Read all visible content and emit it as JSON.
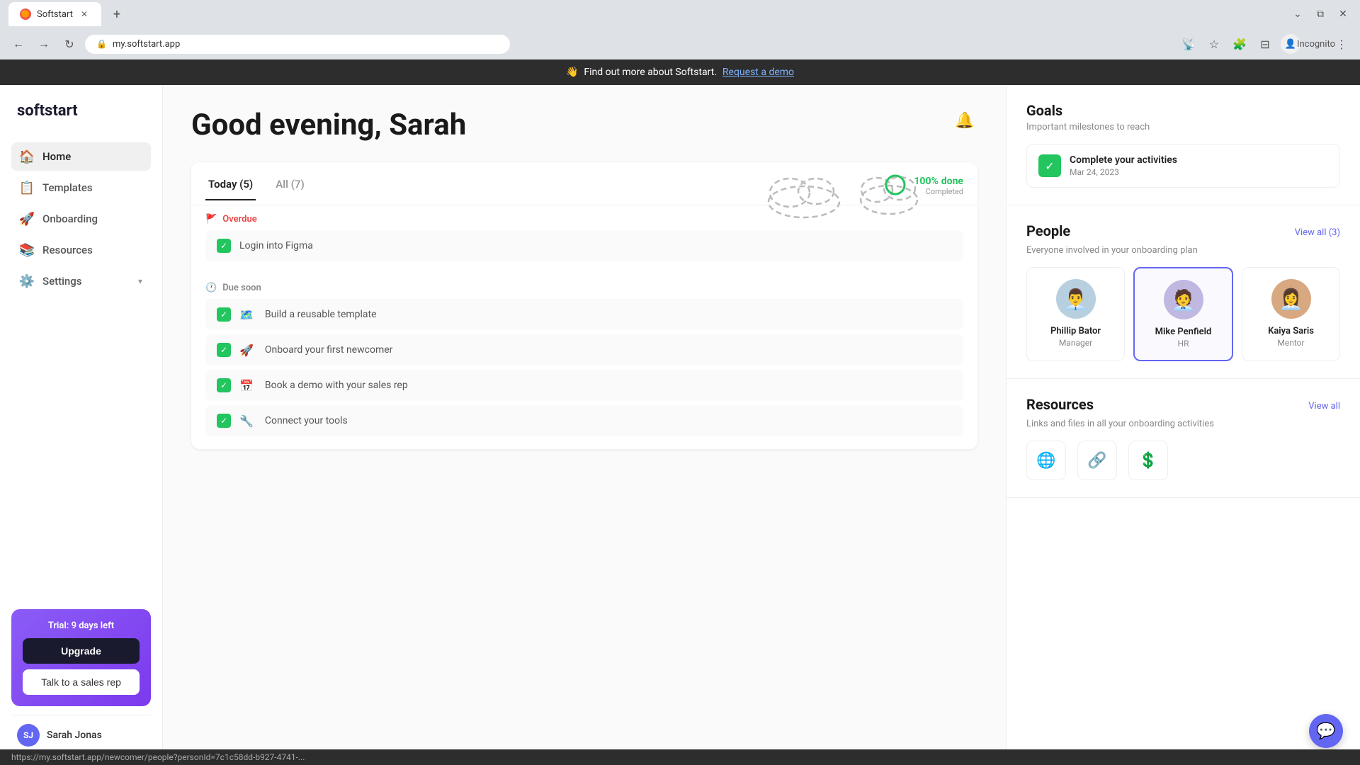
{
  "browser": {
    "tab_title": "Softstart",
    "tab_favicon": "🟠",
    "url": "my.softstart.app",
    "incognito_label": "Incognito"
  },
  "promo": {
    "wave_emoji": "👋",
    "text": "Find out more about Softstart.",
    "link": "Request a demo"
  },
  "sidebar": {
    "logo": "softstart",
    "nav_items": [
      {
        "id": "home",
        "label": "Home",
        "icon": "🏠",
        "active": true
      },
      {
        "id": "templates",
        "label": "Templates",
        "icon": "📋",
        "active": false
      },
      {
        "id": "onboarding",
        "label": "Onboarding",
        "icon": "🚀",
        "active": false
      },
      {
        "id": "resources",
        "label": "Resources",
        "icon": "📚",
        "active": false
      },
      {
        "id": "settings",
        "label": "Settings",
        "icon": "⚙️",
        "active": false,
        "has_arrow": true
      }
    ],
    "trial": {
      "text": "Trial: 9 days left",
      "upgrade_label": "Upgrade",
      "sales_label": "Talk to a sales rep"
    },
    "user": {
      "initials": "SJ",
      "name": "Sarah Jonas"
    }
  },
  "main": {
    "greeting": "Good evening, Sarah",
    "tabs": [
      {
        "label": "Today (5)",
        "active": true
      },
      {
        "label": "All (7)",
        "active": false
      }
    ],
    "progress": {
      "percent": "100%",
      "label": "done",
      "sub_label": "Completed"
    },
    "task_sections": [
      {
        "type": "overdue",
        "icon": "🚩",
        "label": "Overdue",
        "tasks": [
          {
            "emoji": "",
            "label": "Login into Figma",
            "done": true
          }
        ]
      },
      {
        "type": "due_soon",
        "icon": "🕐",
        "label": "Due soon",
        "tasks": [
          {
            "emoji": "🗺️",
            "label": "Build a reusable template",
            "done": true
          },
          {
            "emoji": "🚀",
            "label": "Onboard your first newcomer",
            "done": true
          },
          {
            "emoji": "📅",
            "label": "Book a demo with your sales rep",
            "done": true
          },
          {
            "emoji": "🔧",
            "label": "Connect your tools",
            "done": true
          }
        ]
      }
    ]
  },
  "right_panel": {
    "goals": {
      "title": "Goals",
      "subtitle": "Important milestones to reach",
      "items": [
        {
          "title": "Complete your activities",
          "date": "Mar 24, 2023",
          "done": true
        }
      ]
    },
    "people": {
      "title": "People",
      "subtitle": "Everyone involved in your onboarding plan",
      "view_all": "View all (3)",
      "persons": [
        {
          "name": "Phillip Bator",
          "role": "Manager",
          "avatar_emoji": "👨‍💼",
          "avatar_bg": "#b0c4de"
        },
        {
          "name": "Mike Penfield",
          "role": "HR",
          "avatar_emoji": "🧑‍💼",
          "avatar_bg": "#c0b0de",
          "highlighted": true
        },
        {
          "name": "Kaiya Saris",
          "role": "Mentor",
          "avatar_emoji": "👩‍💼",
          "avatar_bg": "#d0a080"
        }
      ]
    },
    "resources": {
      "title": "Resources",
      "view_all": "View all",
      "subtitle": "Links and files in all your onboarding activities",
      "icons": [
        "🌐",
        "🔗",
        "💲"
      ]
    }
  },
  "status_bar": {
    "url": "https://my.softstart.app/newcomer/people?personId=7c1c58dd-b927-4741-..."
  }
}
